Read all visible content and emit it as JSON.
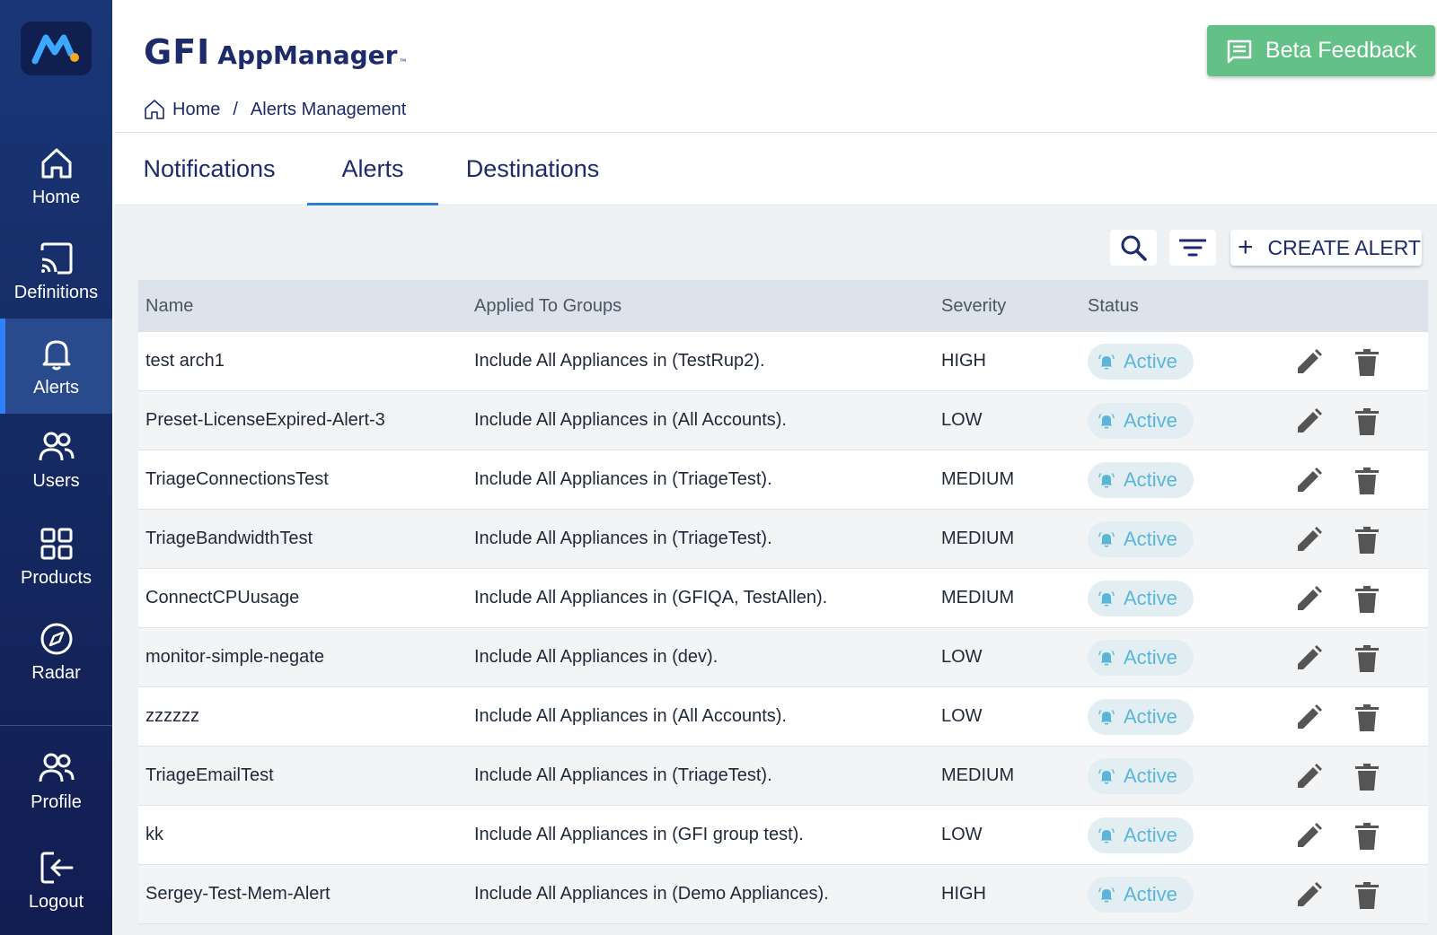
{
  "sidebar": {
    "items": [
      {
        "label": "Home",
        "icon": "home-icon"
      },
      {
        "label": "Definitions",
        "icon": "cast-icon"
      },
      {
        "label": "Alerts",
        "icon": "bell-icon",
        "active": true
      },
      {
        "label": "Users",
        "icon": "users-icon"
      },
      {
        "label": "Products",
        "icon": "grid-icon"
      },
      {
        "label": "Radar",
        "icon": "compass-icon"
      }
    ],
    "bottom_items": [
      {
        "label": "Profile",
        "icon": "profile-icon"
      },
      {
        "label": "Logout",
        "icon": "logout-icon"
      }
    ]
  },
  "header": {
    "brand_gfi": "GFI",
    "brand_app": "AppManager",
    "brand_tm": "™",
    "beta_feedback_label": "Beta Feedback"
  },
  "breadcrumb": {
    "home": "Home",
    "separator": "/",
    "current": "Alerts Management"
  },
  "tabs": [
    {
      "label": "Notifications"
    },
    {
      "label": "Alerts",
      "active": true
    },
    {
      "label": "Destinations"
    }
  ],
  "toolbar": {
    "create_label": "CREATE ALERT"
  },
  "table": {
    "columns": [
      "Name",
      "Applied To Groups",
      "Severity",
      "Status"
    ],
    "rows": [
      {
        "name": "test arch1",
        "groups": "Include All Appliances in (TestRup2).",
        "severity": "HIGH",
        "status": "Active"
      },
      {
        "name": "Preset-LicenseExpired-Alert-3",
        "groups": "Include All Appliances in (All Accounts).",
        "severity": "LOW",
        "status": "Active"
      },
      {
        "name": "TriageConnectionsTest",
        "groups": "Include All Appliances in (TriageTest).",
        "severity": "MEDIUM",
        "status": "Active"
      },
      {
        "name": "TriageBandwidthTest",
        "groups": "Include All Appliances in (TriageTest).",
        "severity": "MEDIUM",
        "status": "Active"
      },
      {
        "name": "ConnectCPUusage",
        "groups": "Include All Appliances in (GFIQA, TestAllen).",
        "severity": "MEDIUM",
        "status": "Active"
      },
      {
        "name": "monitor-simple-negate",
        "groups": "Include All Appliances in (dev).",
        "severity": "LOW",
        "status": "Active"
      },
      {
        "name": "zzzzzz",
        "groups": "Include All Appliances in (All Accounts).",
        "severity": "LOW",
        "status": "Active"
      },
      {
        "name": "TriageEmailTest",
        "groups": "Include All Appliances in (TriageTest).",
        "severity": "MEDIUM",
        "status": "Active"
      },
      {
        "name": "kk",
        "groups": "Include All Appliances in (GFI group test).",
        "severity": "LOW",
        "status": "Active"
      },
      {
        "name": "Sergey-Test-Mem-Alert",
        "groups": "Include All Appliances in (Demo Appliances).",
        "severity": "HIGH",
        "status": "Active"
      }
    ]
  },
  "colors": {
    "sidebar": "#152a63",
    "accent": "#2a7fd4",
    "beta_button": "#63c187",
    "status_text": "#5bb5d8"
  }
}
